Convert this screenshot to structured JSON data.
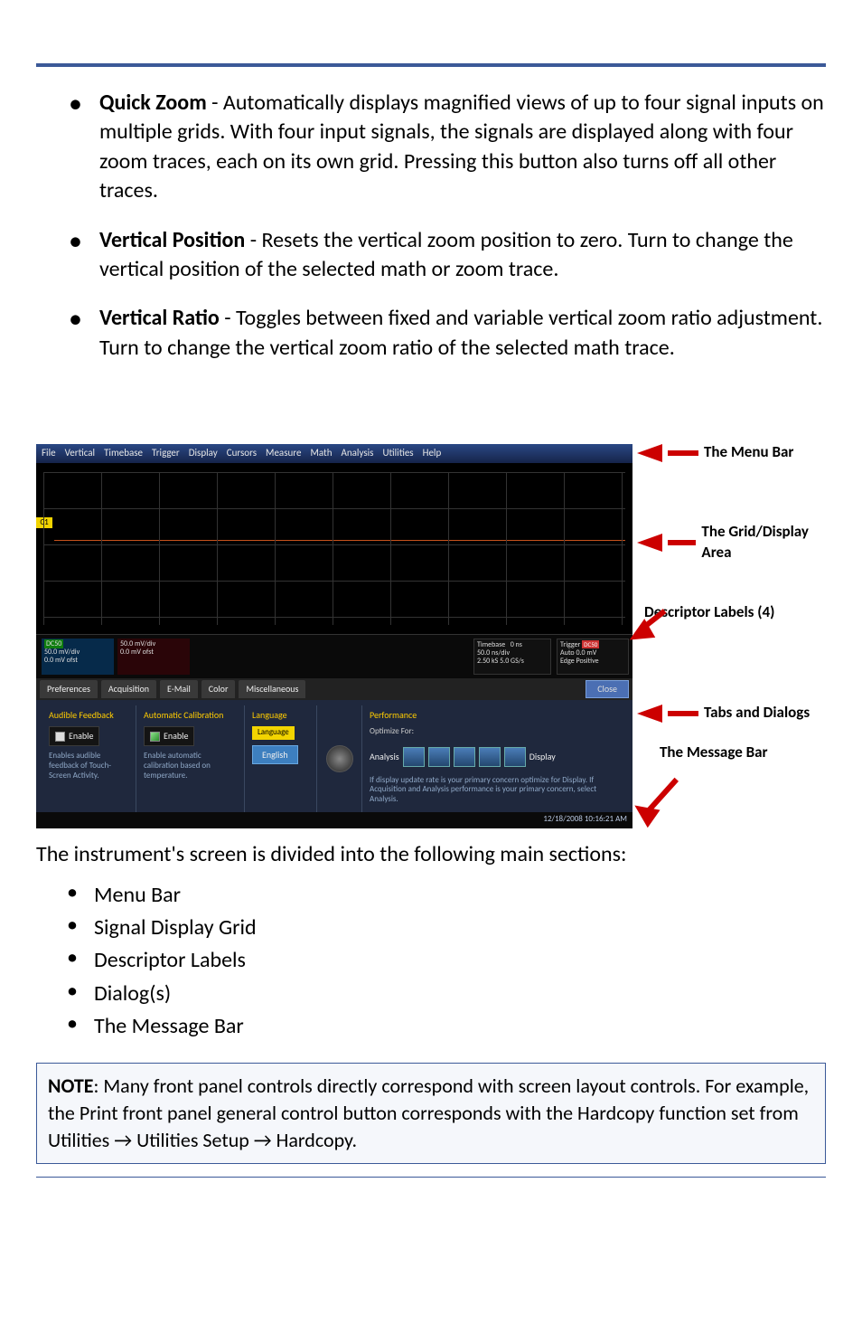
{
  "bullets": [
    {
      "term": "Quick Zoom",
      "text": " - Automatically displays magnified views of up to four signal inputs on multiple grids. With four input signals, the signals are displayed along with four zoom traces, each on its own grid. Pressing this button also turns off all other traces."
    },
    {
      "term": "Vertical Position",
      "text": " - Resets the vertical zoom position to zero. Turn to change the vertical position of the selected math or zoom trace."
    },
    {
      "term": "Vertical Ratio",
      "text": " - Toggles between fixed and variable vertical zoom ratio adjustment. Turn to change the vertical zoom ratio of the selected math trace."
    }
  ],
  "figure": {
    "menu": [
      "File",
      "Vertical",
      "Timebase",
      "Trigger",
      "Display",
      "Cursors",
      "Measure",
      "Math",
      "Analysis",
      "Utilities",
      "Help"
    ],
    "ch1": {
      "tag": "DC50",
      "l1": "50.0 mV/div",
      "l2": "0.0 mV ofst"
    },
    "ch2": {
      "l1": "50.0 mV/div",
      "l2": "0.0 mV ofst"
    },
    "tb": {
      "title": "Timebase",
      "r": "0 ns",
      "l1": "50.0 ns/div",
      "l2": "2.50 kS   5.0 GS/s"
    },
    "trg": {
      "title": "Trigger",
      "tag": "DC50",
      "l1": "Auto   0.0 mV",
      "l2": "Edge   Positive"
    },
    "tabs": [
      "Preferences",
      "Acquisition",
      "E-Mail",
      "Color",
      "Miscellaneous"
    ],
    "close": "Close",
    "dialog": {
      "col1": {
        "hdr": "Audible Feedback",
        "cb": "Enable",
        "desc": "Enables audible feedback of Touch-Screen Activity."
      },
      "col2": {
        "hdr": "Automatic Calibration",
        "cb": "Enable",
        "desc": "Enable automatic calibration based on temperature."
      },
      "col3": {
        "hdr": "Language",
        "lbl": "Language",
        "btn": "English"
      },
      "col5": {
        "hdr": "Performance",
        "opt": "Optimize For:",
        "an": "Analysis",
        "dsp": "Display",
        "txt": "If display update rate is your primary concern optimize for Display. If Acquisition and Analysis performance is your primary concern, select Analysis."
      }
    },
    "datetime": "12/18/2008 10:16:21 AM",
    "annotations": {
      "menu": "The Menu Bar",
      "grid": "The Grid/Display Area",
      "desc": "Descriptor Labels (4)",
      "tabs": "Tabs and Dialogs",
      "msg": "The Message Bar"
    }
  },
  "sections_intro": "The instrument's screen is divided into the following main sections:",
  "sections": [
    "Menu Bar",
    "Signal Display Grid",
    "Descriptor Labels",
    "Dialog(s)",
    "The Message Bar"
  ],
  "note": {
    "label": "NOTE",
    "text": ": Many front panel controls directly correspond with screen layout controls. For example, the Print front panel general control button corresponds with the Hardcopy function set from Utilities → Utilities Setup → Hardcopy."
  }
}
